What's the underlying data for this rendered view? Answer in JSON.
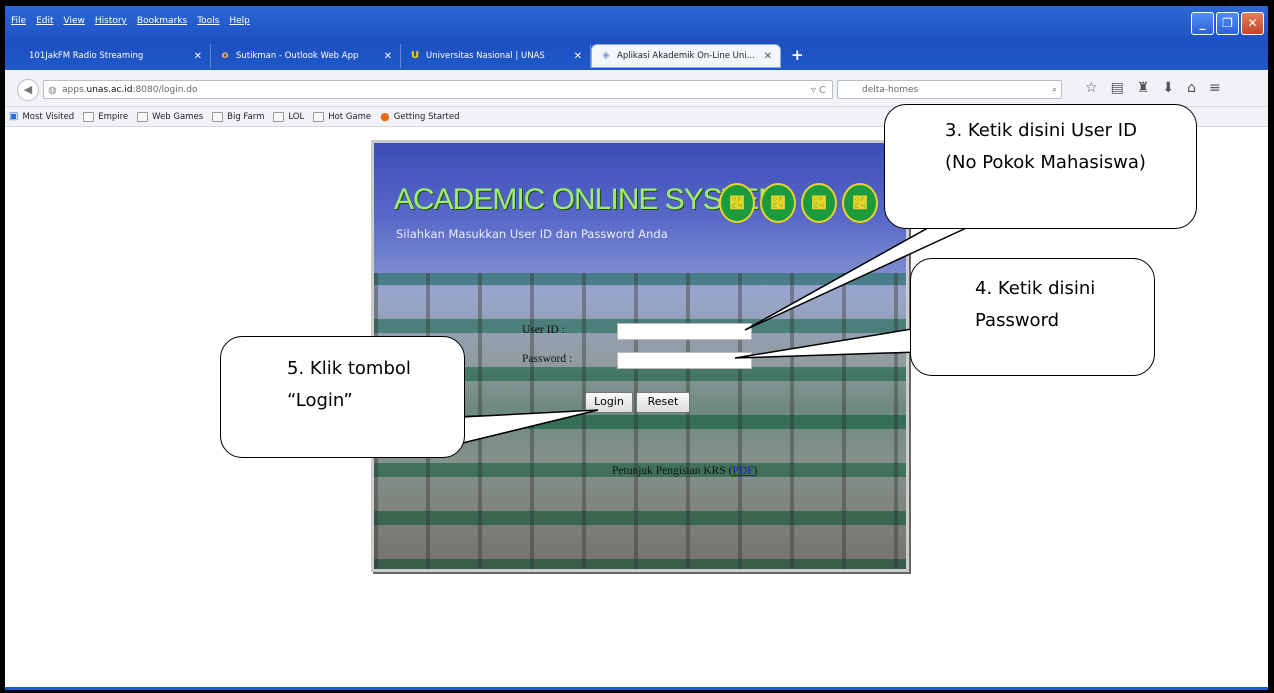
{
  "browser": {
    "menu": [
      "File",
      "Edit",
      "View",
      "History",
      "Bookmarks",
      "Tools",
      "Help"
    ],
    "tabs": [
      {
        "label": "101JakFM Radio Streaming",
        "icon": "",
        "active": false
      },
      {
        "label": "Sutikman - Outlook Web App",
        "icon": "outlook-icon",
        "active": false
      },
      {
        "label": "Universitas Nasional | UNAS",
        "icon": "unas-icon",
        "active": false
      },
      {
        "label": "Aplikasi Akademik On-Line Uni...",
        "icon": "page-icon",
        "active": true
      }
    ],
    "url_prefix": "apps.",
    "url_host": "unas.ac.id",
    "url_rest": ":8080/login.do",
    "search_value": "delta-homes",
    "bookmarks": [
      "Most Visited",
      "Empire",
      "Web Games",
      "Big Farm",
      "LOL",
      "Hot Game",
      "Getting Started"
    ]
  },
  "login": {
    "title": "ACADEMIC ONLINE SYSTEM",
    "subtitle": "Silahkan Masukkan User ID dan Password Anda",
    "seal_glyph": "࿤",
    "userid_label": "User ID :",
    "password_label": "Password :",
    "userid_value": "",
    "password_value": "",
    "login_button": "Login",
    "reset_button": "Reset",
    "krs_text": "Petunjuk Pengisian KRS (",
    "krs_link": "PDF",
    "krs_close": ")"
  },
  "callouts": {
    "c3": "3. Ketik disini User ID (No Pokok Mahasiswa)",
    "c4": "4. Ketik disini Password",
    "c5": "5. Klik tombol “Login”"
  }
}
